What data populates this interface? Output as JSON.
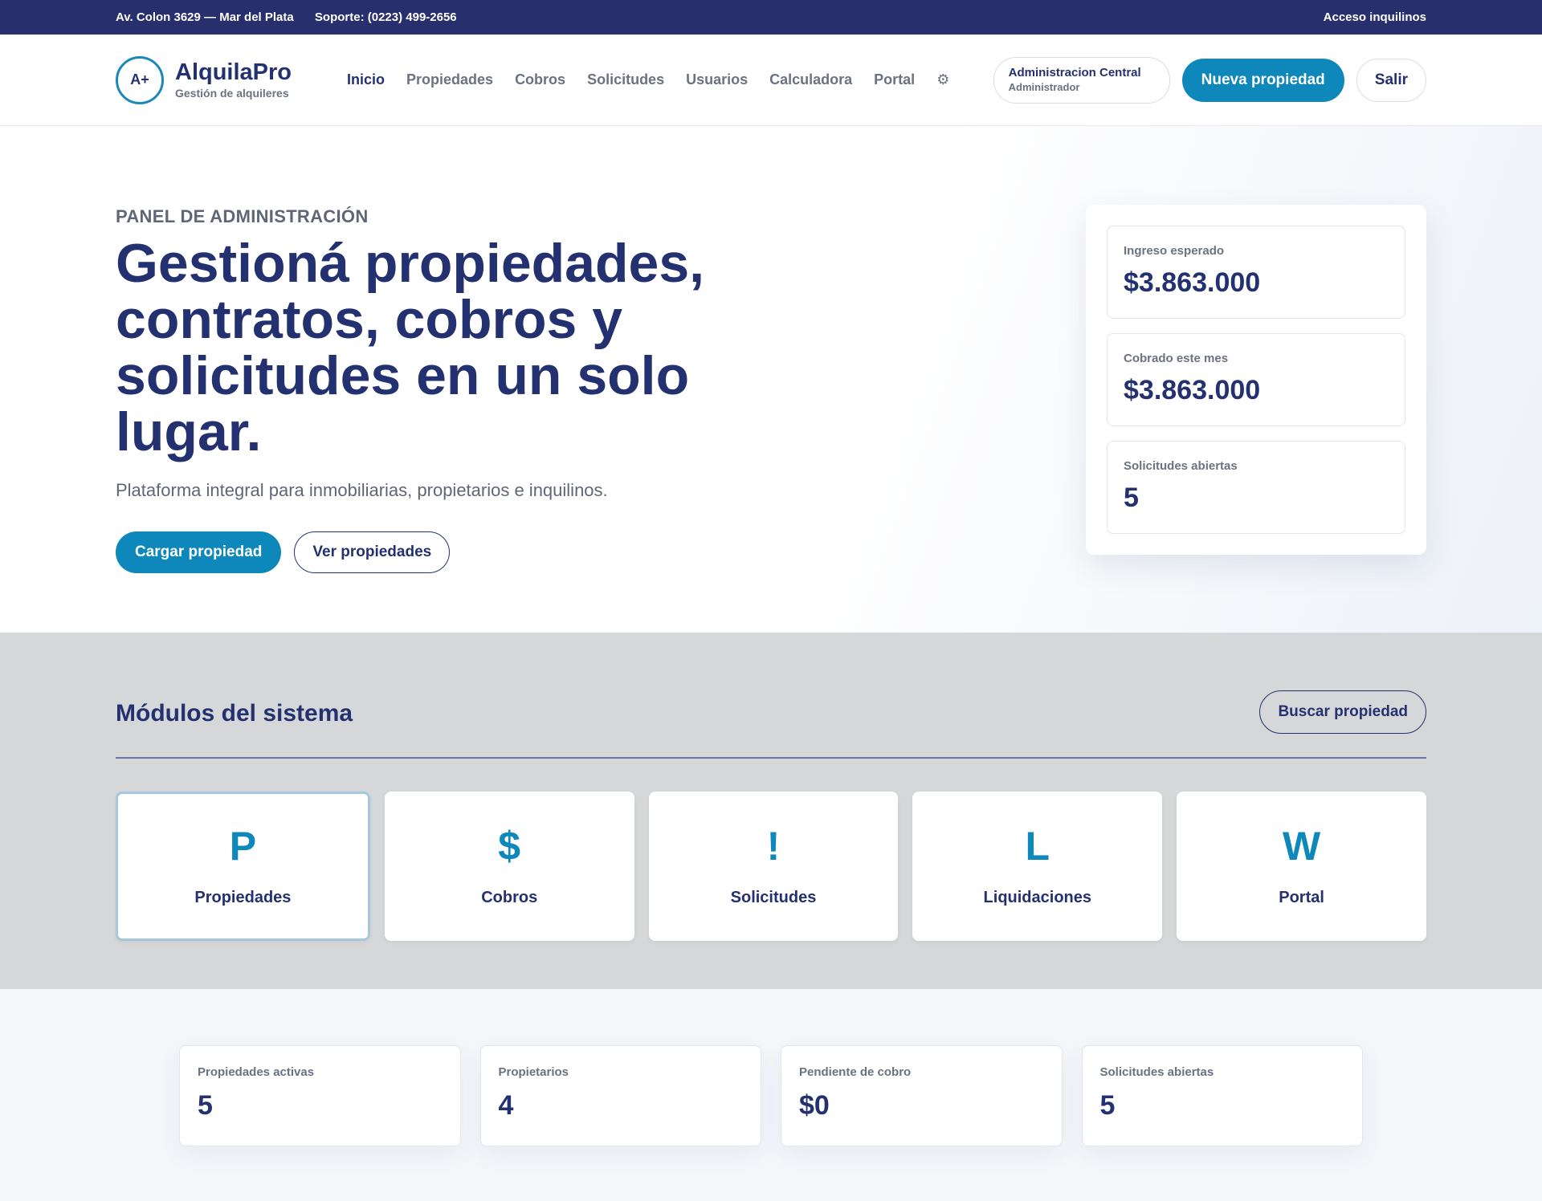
{
  "topbar": {
    "address": "Av. Colon 3629 — Mar del Plata",
    "support": "Soporte: (0223) 499-2656",
    "tenant_access": "Acceso inquilinos"
  },
  "brand": {
    "logo": "A+",
    "name": "AlquilaPro",
    "tagline": "Gestión de alquileres"
  },
  "nav": {
    "items": [
      {
        "label": "Inicio"
      },
      {
        "label": "Propiedades"
      },
      {
        "label": "Cobros"
      },
      {
        "label": "Solicitudes"
      },
      {
        "label": "Usuarios"
      },
      {
        "label": "Calculadora"
      },
      {
        "label": "Portal"
      }
    ],
    "settings_glyph": "⚙"
  },
  "account": {
    "name": "Administracion Central",
    "role": "Administrador"
  },
  "header_actions": {
    "new_property": "Nueva propiedad",
    "logout": "Salir"
  },
  "hero": {
    "eyebrow": "PANEL DE ADMINISTRACIÓN",
    "title": "Gestioná propiedades, contratos, cobros y solicitudes en un solo lugar.",
    "lead": "Plataforma integral para inmobiliarias, propietarios e inquilinos.",
    "primary_cta": "Cargar propiedad",
    "secondary_cta": "Ver propiedades"
  },
  "summary": [
    {
      "label": "Ingreso esperado",
      "value": "$3.863.000"
    },
    {
      "label": "Cobrado este mes",
      "value": "$3.863.000"
    },
    {
      "label": "Solicitudes abiertas",
      "value": "5"
    }
  ],
  "modules": {
    "title": "Módulos del sistema",
    "search_button": "Buscar propiedad",
    "items": [
      {
        "glyph": "P",
        "label": "Propiedades"
      },
      {
        "glyph": "$",
        "label": "Cobros"
      },
      {
        "glyph": "!",
        "label": "Solicitudes"
      },
      {
        "glyph": "L",
        "label": "Liquidaciones"
      },
      {
        "glyph": "W",
        "label": "Portal"
      }
    ]
  },
  "kpis": [
    {
      "label": "Propiedades activas",
      "value": "5"
    },
    {
      "label": "Propietarios",
      "value": "4"
    },
    {
      "label": "Pendiente de cobro",
      "value": "$0"
    },
    {
      "label": "Solicitudes abiertas",
      "value": "5"
    }
  ],
  "colors": {
    "navy": "#27306c",
    "accent": "#0e88bb",
    "text": "#243170"
  }
}
